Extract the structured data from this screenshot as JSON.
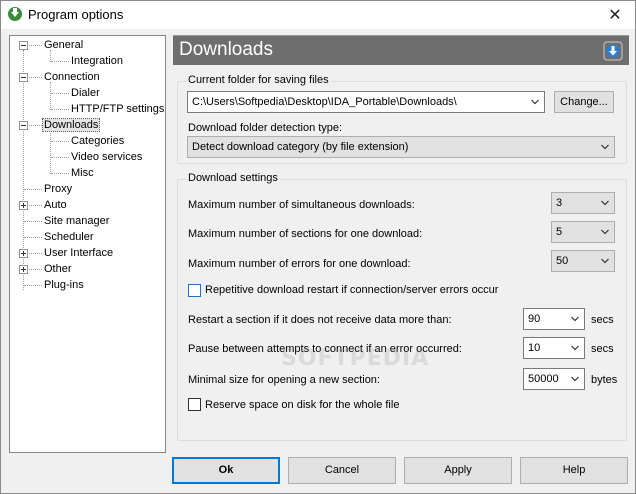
{
  "window": {
    "title": "Program options",
    "close_glyph": "✕"
  },
  "tree": {
    "items": [
      {
        "label": "General"
      },
      {
        "label": "Integration"
      },
      {
        "label": "Connection"
      },
      {
        "label": "Dialer"
      },
      {
        "label": "HTTP/FTP settings"
      },
      {
        "label": "Downloads"
      },
      {
        "label": "Categories"
      },
      {
        "label": "Video services"
      },
      {
        "label": "Misc"
      },
      {
        "label": "Proxy"
      },
      {
        "label": "Auto"
      },
      {
        "label": "Site manager"
      },
      {
        "label": "Scheduler"
      },
      {
        "label": "User Interface"
      },
      {
        "label": "Other"
      },
      {
        "label": "Plug-ins"
      }
    ],
    "selected": "Downloads"
  },
  "header": {
    "title": "Downloads",
    "icon": "download-arrow-icon",
    "band_color": "#6e6e6e"
  },
  "folder_group": {
    "legend": "Current folder for saving files",
    "path": "C:\\Users\\Softpedia\\Desktop\\IDA_Portable\\Downloads\\",
    "change_label": "Change...",
    "detection_label": "Download folder detection type:",
    "detection_value": "Detect download category (by file extension)"
  },
  "settings_group": {
    "legend": "Download settings",
    "max_simultaneous_label": "Maximum number of simultaneous downloads:",
    "max_simultaneous_value": "3",
    "max_sections_label": "Maximum number of sections for one download:",
    "max_sections_value": "5",
    "max_errors_label": "Maximum number of errors for one download:",
    "max_errors_value": "50",
    "repetitive_restart_label": "Repetitive download restart if connection/server errors occur",
    "restart_section_label": "Restart a section if it does not receive data more than:",
    "restart_section_value": "90",
    "restart_section_unit": "secs",
    "pause_label": "Pause between attempts to connect if an error occurred:",
    "pause_value": "10",
    "pause_unit": "secs",
    "min_size_label": "Minimal size for opening a new section:",
    "min_size_value": "50000",
    "min_size_unit": "bytes",
    "reserve_space_label": "Reserve space on disk for the whole file"
  },
  "buttons": {
    "ok": "Ok",
    "cancel": "Cancel",
    "apply": "Apply",
    "help": "Help"
  },
  "watermark": "SOFTPEDIA",
  "colors": {
    "accent": "#0078d7",
    "header_icon": "#2a7fd4"
  }
}
